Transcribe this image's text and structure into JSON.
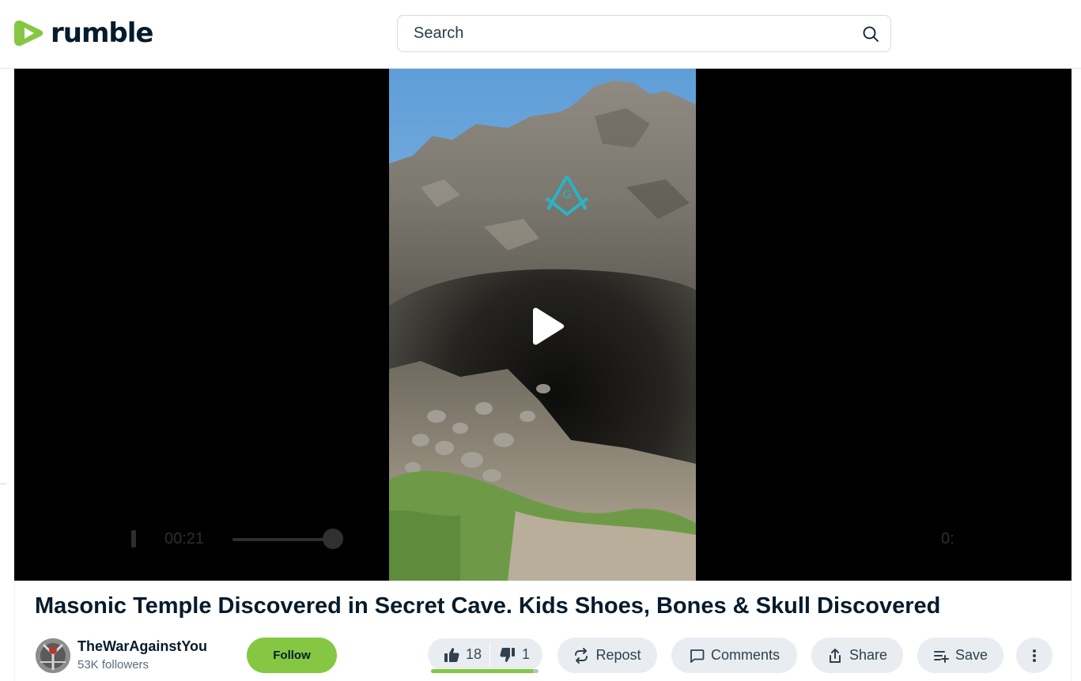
{
  "header": {
    "logo_text": "rumble",
    "search_placeholder": "Search",
    "brand_color": "#85c742"
  },
  "player": {
    "current_time": "00:21",
    "end_time_partial": "0:",
    "progress": 0.88,
    "state": "paused"
  },
  "video": {
    "title": "Masonic Temple Discovered in Secret Cave. Kids Shoes, Bones & Skull Discovered"
  },
  "channel": {
    "name": "TheWarAgainstYou",
    "followers": "53K followers",
    "follow_label": "Follow"
  },
  "votes": {
    "up": "18",
    "down": "1",
    "ratio": 0.95
  },
  "actions": {
    "repost_label": "Repost",
    "comments_label": "Comments",
    "share_label": "Share",
    "save_label": "Save"
  },
  "icons": [
    "rumble-logo-icon",
    "search-icon",
    "play-icon",
    "thumbs-up-icon",
    "thumbs-down-icon",
    "repost-icon",
    "comment-icon",
    "share-icon",
    "save-playlist-icon",
    "more-vertical-icon"
  ]
}
